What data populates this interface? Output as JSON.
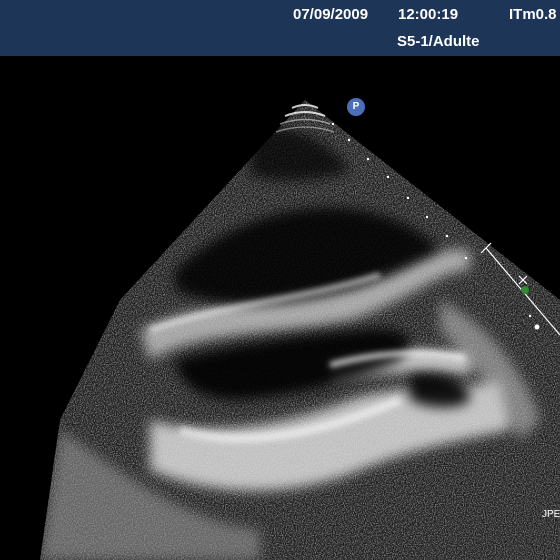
{
  "header": {
    "date": "07/09/2009",
    "time": "12:00:19",
    "index": "ITm0.8",
    "probe": "S5-1/Adulte"
  },
  "image": {
    "orientation_marker": "P",
    "corner_label": "JPE",
    "accent_color": "#1d3557",
    "marker_color": "#4a6fb8",
    "caliper_color": "#2e8b2e"
  }
}
